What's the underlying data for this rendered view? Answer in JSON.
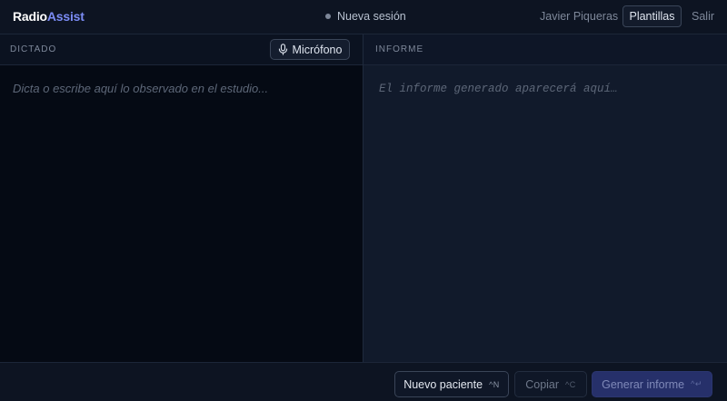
{
  "header": {
    "brand_part1": "Radio",
    "brand_part2": "Assist",
    "session_status": "Nueva sesión",
    "user_name": "Javier Piqueras",
    "templates_label": "Plantillas",
    "logout_label": "Salir"
  },
  "dictation": {
    "title": "DICTADO",
    "mic_label": "Micrófono",
    "mic_icon": "microphone-icon",
    "placeholder": "Dicta o escribe aquí lo observado en el estudio..."
  },
  "report": {
    "title": "INFORME",
    "placeholder": "El informe generado aparecerá aquí…"
  },
  "footer": {
    "new_patient_label": "Nuevo paciente",
    "new_patient_shortcut": "^N",
    "copy_label": "Copiar",
    "copy_shortcut": "^C",
    "generate_label": "Generar informe",
    "generate_shortcut": "^↵"
  },
  "colors": {
    "accent": "#7b8cf5",
    "primary_button": "#26306a",
    "background": "#0b1220"
  }
}
